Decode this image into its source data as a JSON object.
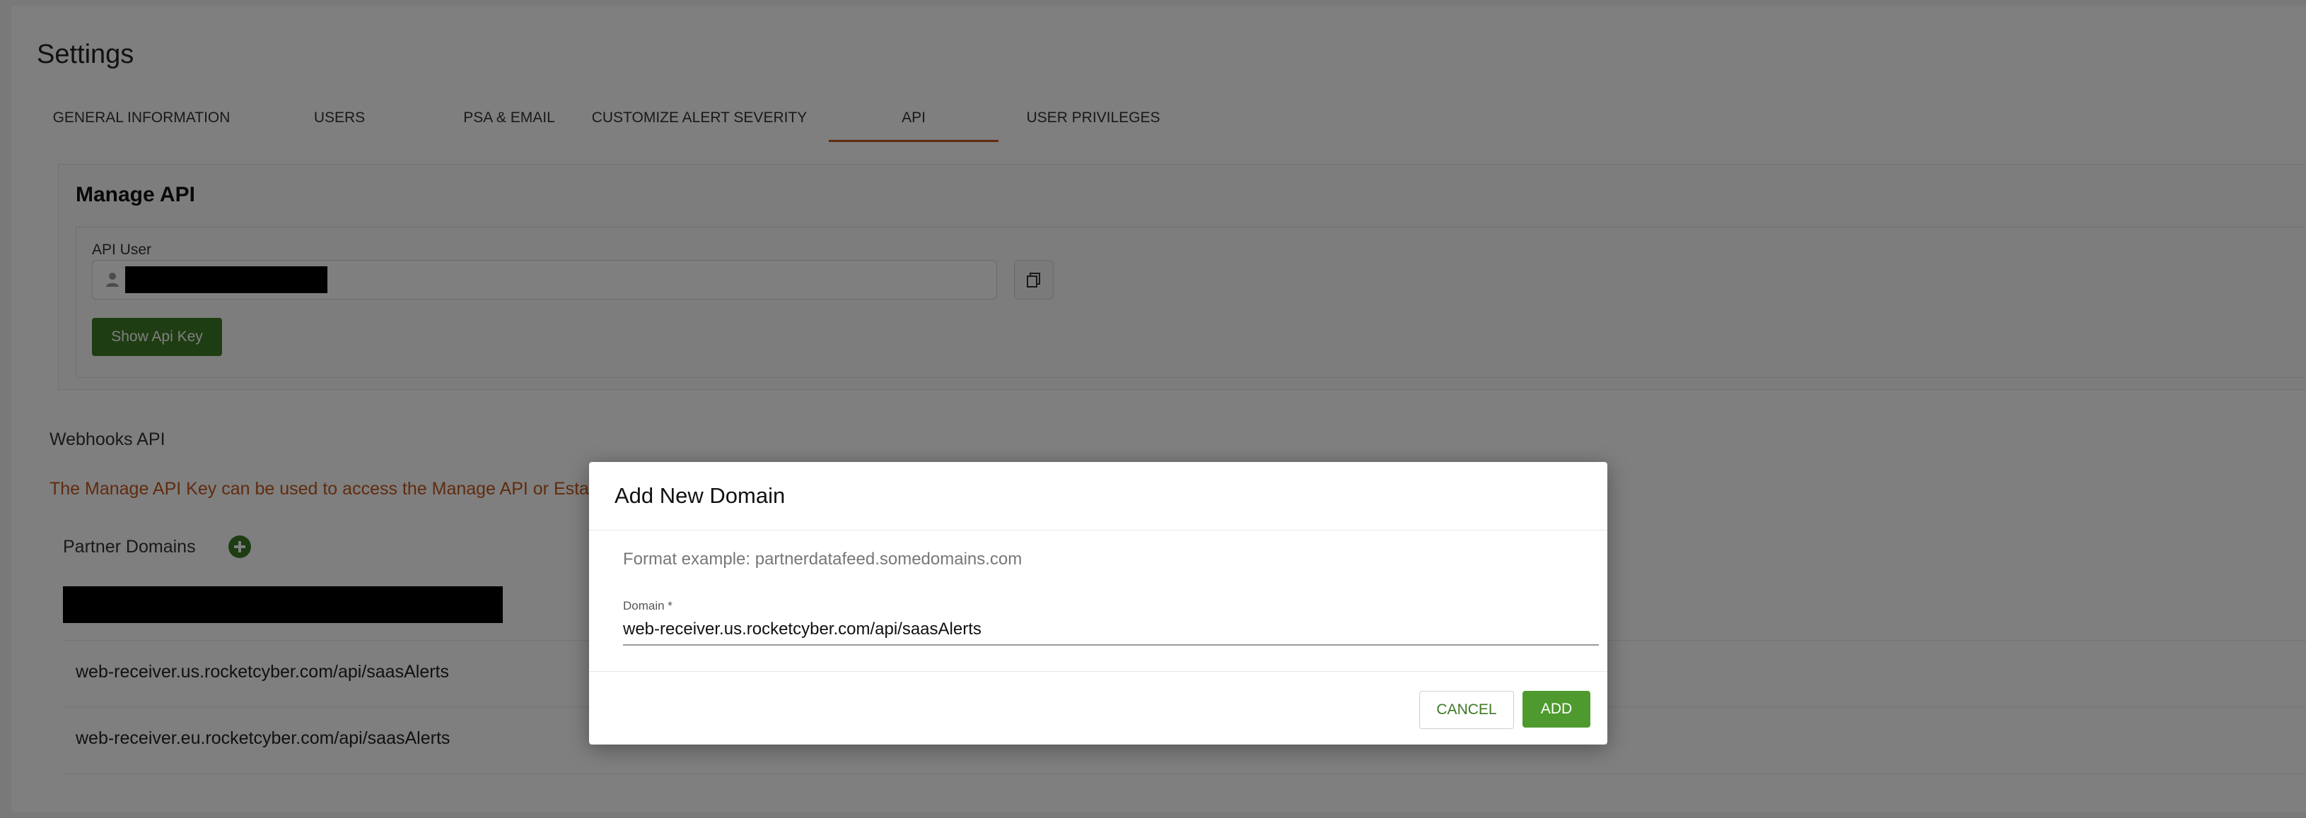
{
  "page": {
    "title": "Settings"
  },
  "tabs": [
    {
      "label": "GENERAL INFORMATION"
    },
    {
      "label": "USERS"
    },
    {
      "label": "PSA & EMAIL"
    },
    {
      "label": "CUSTOMIZE ALERT SEVERITY"
    },
    {
      "label": "API",
      "active": true
    },
    {
      "label": "USER PRIVILEGES"
    }
  ],
  "manage_api": {
    "title": "Manage API",
    "api_user_label": "API User",
    "show_key_label": "Show Api Key"
  },
  "webhooks": {
    "title": "Webhooks API",
    "note": "The Manage API Key can be used to access the Manage API or Esta",
    "partner_domains_title": "Partner Domains",
    "domains": [
      "web-receiver.us.rocketcyber.com/api/saasAlerts",
      "web-receiver.eu.rocketcyber.com/api/saasAlerts"
    ]
  },
  "modal": {
    "title": "Add New Domain",
    "format_example": "Format example: partnerdatafeed.somedomains.com",
    "domain_label": "Domain *",
    "domain_value": "web-receiver.us.rocketcyber.com/api/saasAlerts",
    "cancel_label": "CANCEL",
    "add_label": "ADD"
  },
  "colors": {
    "accent": "#c0571e",
    "primary_green": "#3d7a24",
    "add_green": "#4e9a2e"
  },
  "icons": {
    "user": "user-icon",
    "copy": "copy-icon",
    "add": "add-circle-icon"
  }
}
